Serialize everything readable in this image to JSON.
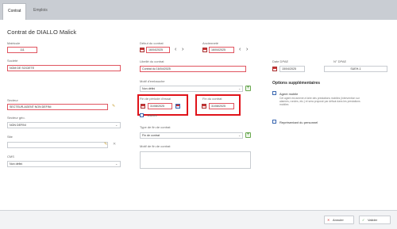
{
  "tabs": [
    {
      "label": "Contrat"
    },
    {
      "label": "Emplois"
    }
  ],
  "page_title": "Contrat de DIALLO Malick",
  "matricule": {
    "label": "Matricule",
    "value": "111"
  },
  "societe": {
    "label": "Société",
    "value": "NOM DE SOCIETE"
  },
  "secteur": {
    "label": "Secteur",
    "value": "SECTEUR-AGENT NON DEFINI"
  },
  "secteur_geo": {
    "label": "Secteur géo.",
    "value": "NON DEFINI"
  },
  "site": {
    "label": "Site",
    "value": ""
  },
  "cms": {
    "label": "CMS",
    "value": "Non défini"
  },
  "debut_contrat": {
    "label": "Début du contrat",
    "value": "16/04/2025"
  },
  "anciennete": {
    "label": "Ancienneté",
    "value": "16/04/2025"
  },
  "libelle_contrat": {
    "label": "Libellé du contrat",
    "value": "Contrat du 16/04/2025"
  },
  "motif_embauche": {
    "label": "Motif d'embauche",
    "value": "Non défini"
  },
  "fin_essai": {
    "label": "Fin de période d'essai",
    "value": "31/08/2025"
  },
  "fin_contrat": {
    "label": "Fin du contrat",
    "value": "31/08/2025"
  },
  "validee": {
    "label": "Validée"
  },
  "type_fin": {
    "label": "Type de fin de contrat",
    "value": "Fin de contrat"
  },
  "motif_fin": {
    "label": "Motif de fin de contrat",
    "value": ""
  },
  "date_dpae": {
    "label": "Date DPAE",
    "value": "15/04/2025"
  },
  "num_dpae": {
    "label": "N° DPAE",
    "value": "SUEH-1"
  },
  "options": {
    "title": "Options supplémentaires",
    "agent_mobile": {
      "label": "Agent mobile",
      "note": "Cet agent est amené à faire des prestations mobiles (intervention sur alarmes, rondes, etc.) et sera proposé par défaut dans les prestations mobiles"
    },
    "representant": {
      "label": "Représentant du personnel"
    }
  },
  "footer": {
    "cancel_label": "Annuler",
    "validate_label": "Valider"
  },
  "colors": {
    "error_border": "#e05560",
    "highlight": "#e0131a",
    "validate": "#2e8b2e"
  }
}
